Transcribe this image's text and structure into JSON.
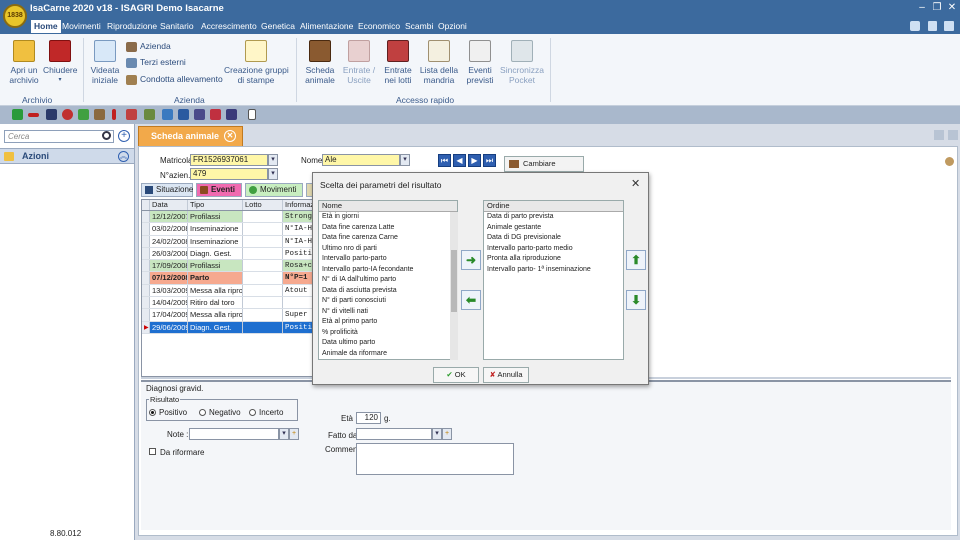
{
  "app": {
    "title": "IsaCarne 2020 v18 - ISAGRI Demo Isacarne",
    "logo_text": "1838",
    "version": "8.80.012"
  },
  "menu": [
    "Home",
    "Movimenti",
    "Riproduzione",
    "Sanitario",
    "Accrescimento",
    "Genetica",
    "Alimentazione",
    "Economico",
    "Scambi",
    "Opzioni"
  ],
  "ribbon": {
    "archivio": {
      "label": "Archivio",
      "open": "Apri un\narchivio",
      "close": "Chiudere"
    },
    "azienda": {
      "label": "Azienda",
      "view": "Videata\niniziale",
      "azienda": "Azienda",
      "terzi": "Terzi esterni",
      "condotta": "Condotta allevamento",
      "gruppi": "Creazione gruppi\ndi stampe"
    },
    "accesso": {
      "label": "Accesso rapido",
      "scheda": "Scheda\nanimale",
      "entrate_uscite": "Entrate /\nUscite",
      "entrate_lotti": "Entrate\nnei lotti",
      "lista": "Lista della\nmandria",
      "eventi": "Eventi\nprevisti",
      "sync": "Sincronizza\nPocket"
    }
  },
  "sidebar": {
    "search_placeholder": "Cerca",
    "azioni": "Azioni"
  },
  "tab": {
    "scheda": "Scheda animale"
  },
  "header": {
    "matricola_label": "Matricola",
    "matricola": "FR1526937061",
    "nazien_label": "N°azien.",
    "nazien": "479",
    "nome_label": "Nome",
    "nome": "Ale",
    "change_button": "Cambiare animale"
  },
  "subtabs": [
    "Situazione",
    "Eventi",
    "Movimenti"
  ],
  "grid": {
    "columns": [
      "Data",
      "Tipo",
      "Lotto",
      "Informazi"
    ],
    "rows": [
      {
        "date": "12/12/2007",
        "type": "Profilassi",
        "lot": "",
        "info": "Strong",
        "style": "green"
      },
      {
        "date": "03/02/2008",
        "type": "Inseminazione",
        "lot": "",
        "info": "N°IA-HE",
        "style": "white"
      },
      {
        "date": "24/02/2008",
        "type": "Inseminazione",
        "lot": "",
        "info": "N°IA-HE",
        "style": "white"
      },
      {
        "date": "26/03/2008",
        "type": "Diagn. Gest.",
        "lot": "",
        "info": "Positi",
        "style": "white"
      },
      {
        "date": "17/09/2008",
        "type": "Profilassi",
        "lot": "",
        "info": "Rosa+c",
        "style": "green"
      },
      {
        "date": "07/12/2008",
        "type": "Parto",
        "lot": "",
        "info": "N°P=1",
        "style": "red"
      },
      {
        "date": "13/03/2009",
        "type": "Messa alla riprodu",
        "lot": "",
        "info": "Atout",
        "style": "white"
      },
      {
        "date": "14/04/2009",
        "type": "Ritiro dal toro",
        "lot": "",
        "info": "",
        "style": "white"
      },
      {
        "date": "17/04/2009",
        "type": "Messa alla riprodu",
        "lot": "",
        "info": "Super",
        "style": "white"
      },
      {
        "date": "29/06/2009",
        "type": "Diagn. Gest.",
        "lot": "",
        "info": "Positi",
        "style": "selected"
      }
    ]
  },
  "detail": {
    "section": "Diagnosi gravid.",
    "risultato": "Risultato",
    "options": [
      "Positivo",
      "Negativo",
      "Incerto"
    ],
    "note_label": "Note :",
    "riformare": "Da riformare",
    "eta_label": "Età :",
    "eta": "120",
    "eta_unit": "g.",
    "fatto_label": "Fatto da:",
    "commenti_label": "Commenti:"
  },
  "dialog": {
    "title": "Scelta dei parametri del risultato",
    "left_header": "Nome",
    "left_items": [
      "Età in giorni",
      "Data fine carenza Latte",
      "Data fine carenza Carne",
      "Ultimo nro di parti",
      "Intervallo parto-parto",
      "Intervallo parto-IA fecondante",
      "N° di IA dall'ultimo parto",
      "Data di asciutta prevista",
      "N° di parti conosciuti",
      "N° di vitelli nati",
      "Età al primo parto",
      "% prolificità",
      "Data ultimo parto",
      "Animale da riformare"
    ],
    "right_header": "Ordine",
    "right_items": [
      "Data di parto prevista",
      "Animale gestante",
      "Data di DG previsionale",
      "Intervallo parto-parto medio",
      "Pronta alla riproduzione",
      "Intervallo parto- 1ª inseminazione"
    ],
    "ok": "OK",
    "cancel": "Annulla"
  },
  "colors": {
    "title_blue": "#3c6a9e",
    "tab_orange": "#f2a94a",
    "row_green": "#c8e6c0",
    "row_red": "#f6a98f",
    "row_selected": "#1e6fd0"
  }
}
